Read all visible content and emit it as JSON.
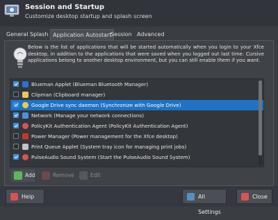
{
  "header": {
    "title": "Session and Startup",
    "subtitle": "Customize desktop startup and splash screen",
    "icon": "session-monitor-icon"
  },
  "tabs": [
    {
      "label": "General",
      "active": false
    },
    {
      "label": "Splash",
      "active": false
    },
    {
      "label": "Application Autostart",
      "active": true
    },
    {
      "label": "Session",
      "active": false
    },
    {
      "label": "Advanced",
      "active": false
    }
  ],
  "info_text": "Below is the list of applications that will be started automatically when you login to your Xfce desktop, in addition to the applications that were saved when you logged out last time. Cursive applications belong to another desktop environment, but you can still enable them if you want.",
  "autostart": {
    "items": [
      {
        "label": "Blueman Applet (Blueman Bluetooth Manager)",
        "checked": true,
        "selected": false,
        "icon_color": "#2b6fd6"
      },
      {
        "label": "Clipman (Clipboard manager)",
        "checked": false,
        "selected": false,
        "icon_color": "#e8c75a"
      },
      {
        "label": "Google Drive sync daemon (Synchronize with Google Drive)",
        "checked": true,
        "selected": true,
        "icon_color": "#f2c94c"
      },
      {
        "label": "Network (Manage your network connections)",
        "checked": true,
        "selected": false,
        "icon_color": "#4a90e2"
      },
      {
        "label": "PolicyKit Authentication Agent (PolicyKit Authentication Agent)",
        "checked": true,
        "selected": false,
        "icon_color": "#d9534f"
      },
      {
        "label": "Power Manager (Power management for the Xfce desktop)",
        "checked": false,
        "selected": false,
        "icon_color": "#c0392b"
      },
      {
        "label": "Print Queue Applet (System tray icon for managing print jobs)",
        "checked": false,
        "selected": false,
        "icon_color": "#bfc4ca"
      },
      {
        "label": "PulseAudio Sound System (Start the PulseAudio Sound System)",
        "checked": true,
        "selected": false,
        "icon_color": "#d9534f"
      }
    ]
  },
  "list_buttons": {
    "add": "Add",
    "remove": "Remove",
    "edit": "Edit"
  },
  "footer": {
    "help": "Help",
    "all_settings": "All Settings",
    "close": "Close"
  }
}
